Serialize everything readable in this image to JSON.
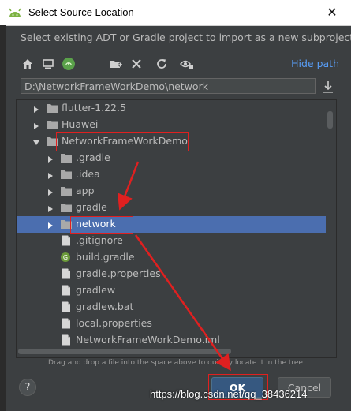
{
  "window": {
    "title": "Select Source Location",
    "close_glyph": "✕"
  },
  "description": "Select existing ADT or Gradle project to import as a new subproject",
  "toolbar": {
    "icons": [
      "home-icon",
      "desktop-icon",
      "android-project-icon",
      "new-folder-icon",
      "delete-icon",
      "refresh-icon",
      "show-hidden-icon"
    ],
    "hide_path_label": "Hide path"
  },
  "path_field": {
    "value": "D:\\NetworkFrameWorkDemo\\network"
  },
  "tree": {
    "rows": [
      {
        "label": "flutter-1.22.5",
        "type": "folder",
        "expanded": false
      },
      {
        "label": "Huawei",
        "type": "folder",
        "expanded": false
      },
      {
        "label": "NetworkFrameWorkDemo",
        "type": "folder",
        "expanded": true
      },
      {
        "label": ".gradle",
        "type": "folder",
        "expanded": false
      },
      {
        "label": ".idea",
        "type": "folder",
        "expanded": false
      },
      {
        "label": "app",
        "type": "folder",
        "expanded": false
      },
      {
        "label": "gradle",
        "type": "folder",
        "expanded": false
      },
      {
        "label": "network",
        "type": "folder",
        "expanded": false,
        "selected": true
      },
      {
        "label": ".gitignore",
        "type": "file"
      },
      {
        "label": "build.gradle",
        "type": "gradle"
      },
      {
        "label": "gradle.properties",
        "type": "file"
      },
      {
        "label": "gradlew",
        "type": "file"
      },
      {
        "label": "gradlew.bat",
        "type": "file"
      },
      {
        "label": "local.properties",
        "type": "file"
      },
      {
        "label": "NetworkFrameWorkDemo.iml",
        "type": "file"
      }
    ]
  },
  "hint": "Drag and drop a file into the space above to quickly locate it in the tree",
  "buttons": {
    "help": "?",
    "ok": "OK",
    "cancel": "Cancel"
  },
  "watermark": "https://blog.csdn.net/qq_38436214",
  "colors": {
    "selection": "#4b6eaf",
    "annotation": "#e02020",
    "link": "#589df6",
    "background": "#3c3f41"
  }
}
